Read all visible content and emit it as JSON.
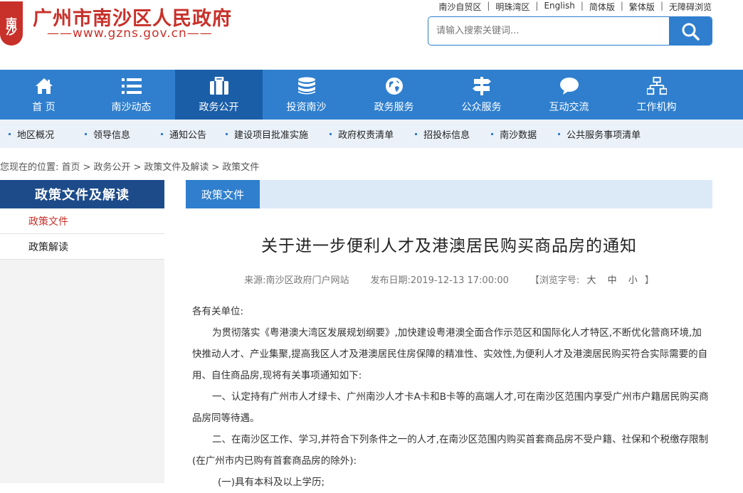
{
  "header": {
    "logo_char_1": "南",
    "logo_char_2": "沙",
    "title": "广州市南沙区人民政府",
    "url": "——www.gzns.gov.cn——"
  },
  "toplinks": [
    "南沙自贸区",
    "明珠湾区",
    "English",
    "简体版",
    "繁体版",
    "无障碍浏览"
  ],
  "toplink_sep": "|",
  "search": {
    "placeholder": "请输入搜索关键词...",
    "icon": "search-icon"
  },
  "nav": [
    {
      "label": "首 页",
      "icon": "home-icon"
    },
    {
      "label": "南沙动态",
      "icon": "list-icon"
    },
    {
      "label": "政务公开",
      "icon": "briefcase-icon",
      "active": true
    },
    {
      "label": "投资南沙",
      "icon": "database-icon"
    },
    {
      "label": "政务服务",
      "icon": "globe-icon"
    },
    {
      "label": "公众服务",
      "icon": "signpost-icon"
    },
    {
      "label": "互动交流",
      "icon": "chat-icon"
    },
    {
      "label": "工作机构",
      "icon": "org-chart-icon"
    }
  ],
  "subnav": [
    "地区概况",
    "领导信息",
    "通知公告",
    "建设项目批准实施",
    "政府权责清单",
    "招投标信息",
    "南沙数据",
    "公共服务事项清单"
  ],
  "breadcrumb": {
    "prefix": "您现在的位置:",
    "items": [
      "首页",
      "政务公开",
      "政策文件及解读",
      "政策文件"
    ],
    "sep": ">"
  },
  "sidebar": {
    "title": "政策文件及解读",
    "items": [
      {
        "label": "政策文件",
        "active": true
      },
      {
        "label": "政策解读"
      }
    ]
  },
  "content": {
    "tab": "政策文件",
    "title": "关于进一步便利人才及港澳居民购买商品房的通知",
    "meta": {
      "source": "来源:南沙区政府门户网站",
      "date": "发布日期:2019-12-13 17:00:00",
      "fontsize_label": "【浏览字号:",
      "sizes": [
        "大",
        "中",
        "小"
      ],
      "fontsize_end": "】"
    },
    "paragraphs": [
      "各有关单位:",
      "为贯彻落实《粤港澳大湾区发展规划纲要》,加快建设粤港澳全面合作示范区和国际化人才特区,不断优化营商环境,加快推动人才、产业集聚,提高我区人才及港澳居民住房保障的精准性、实效性,为便利人才及港澳居民购买符合实际需要的自用、自住商品房,现将有关事项通知如下:",
      "一、认定持有广州市人才绿卡、广州南沙人才卡A卡和B卡等的高端人才,可在南沙区范围内享受广州市户籍居民购买商品房同等待遇。",
      "二、在南沙区工作、学习,并符合下列条件之一的人才,在南沙区范围内购买首套商品房不受户籍、社保和个税缴存限制(在广州市内已购有首套商品房的除外):",
      "(一)具有本科及以上学历;"
    ]
  },
  "colors": {
    "brand_red": "#c8302a",
    "nav_blue": "#2f7fce",
    "nav_active": "#1a5ea8",
    "sidebar_head": "#1d4b8a"
  }
}
